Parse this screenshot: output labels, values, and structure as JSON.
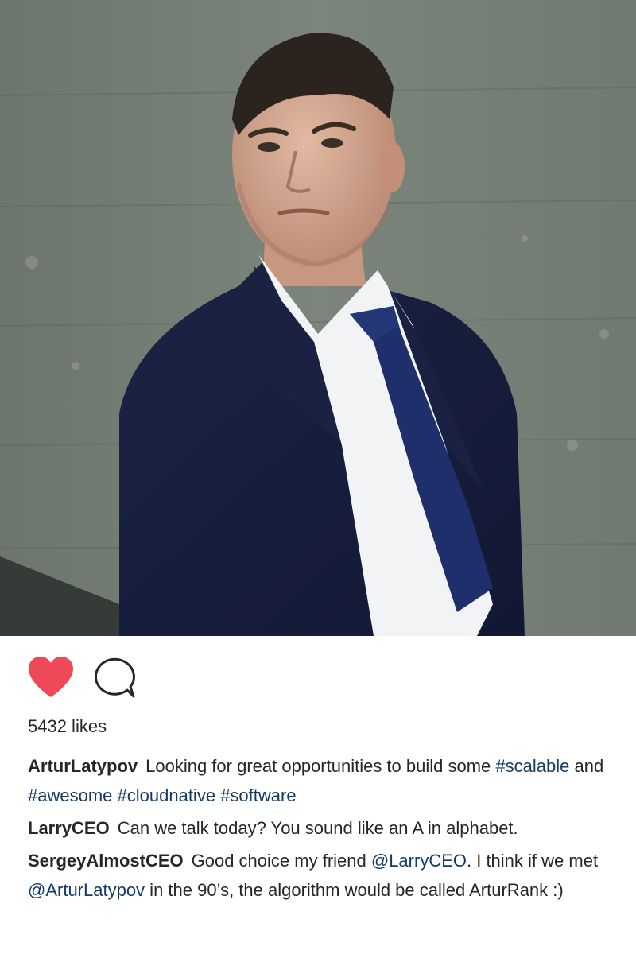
{
  "post": {
    "photo": {
      "alt": ""
    },
    "actions": {
      "like_icon": "heart-filled-icon",
      "comment_icon": "speech-bubble-icon",
      "like_color": "#ed4956",
      "liked": true
    },
    "likes_text": "5432 likes",
    "comments": [
      {
        "user": "ArturLatypov",
        "t1": "Looking for great opportunities to build some ",
        "h1": "#scalable",
        "t2": " and ",
        "h2": "#awesome",
        "t3": " ",
        "h3": "#cloudnative",
        "t4": " ",
        "h4": "#software"
      },
      {
        "user": "LarryCEO",
        "t1": "Can we talk today? You sound like an A in alphabet."
      },
      {
        "user": "SergeyAlmostCEO",
        "t1": "Good choice my friend ",
        "m1": "@LarryCEO",
        "t2": ". I think if we met ",
        "m2": "@ArturLatypov",
        "t3": " in the 90’s, the algorithm would be called ArturRank :)"
      }
    ],
    "colors": {
      "link": "#143a66",
      "text": "#262626"
    }
  }
}
